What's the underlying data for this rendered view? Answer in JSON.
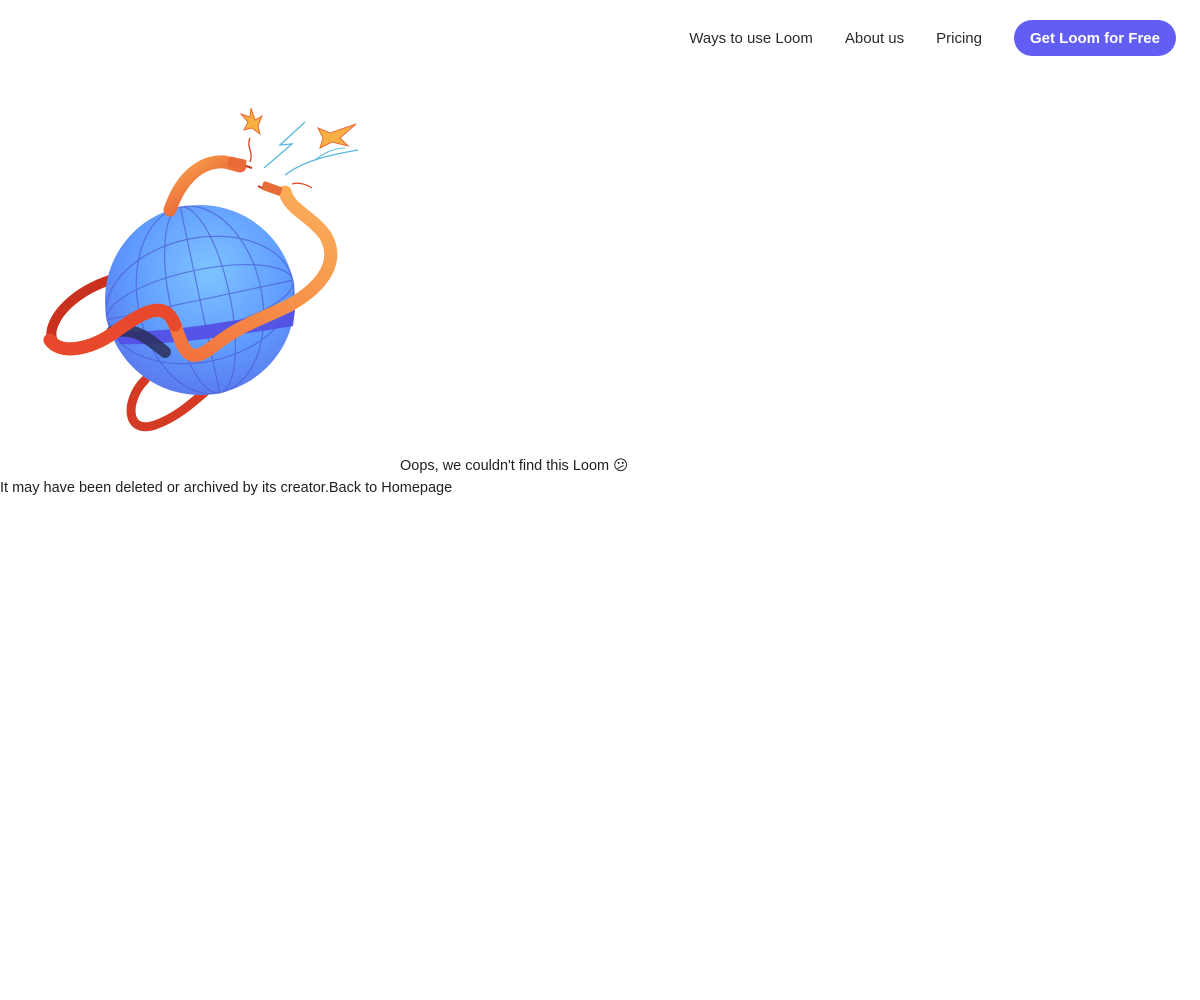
{
  "nav": {
    "links": [
      {
        "label": "Ways to use Loom"
      },
      {
        "label": "About us"
      },
      {
        "label": "Pricing"
      }
    ],
    "cta_label": "Get Loom for Free"
  },
  "error": {
    "title": "Oops, we couldn't find this Loom 😕",
    "description": "It may have been deleted or archived by its creator.",
    "home_link": "Back to Homepage"
  },
  "colors": {
    "accent": "#625df5",
    "globe": "#6aa7ff",
    "cable_orange": "#f7894a",
    "cable_red": "#e0452d"
  }
}
